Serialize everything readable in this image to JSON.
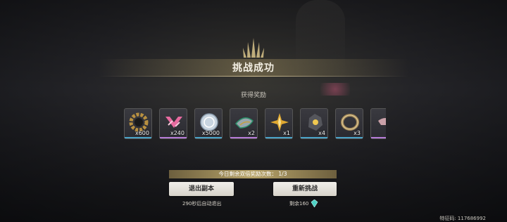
{
  "header": {
    "title": "挑战成功",
    "subtitle": "获得奖励"
  },
  "rewards": [
    {
      "icon": "gear-ring-icon",
      "qty": "x600",
      "rarity": "blue",
      "color": "#4aa3c7"
    },
    {
      "icon": "pink-emblem-icon",
      "qty": "x240",
      "rarity": "purple",
      "color": "#b57ad6"
    },
    {
      "icon": "silver-coin-icon",
      "qty": "x5000",
      "rarity": "blue",
      "color": "#4aa3c7"
    },
    {
      "icon": "shell-icon",
      "qty": "x2",
      "rarity": "purple",
      "color": "#b57ad6"
    },
    {
      "icon": "gold-star-icon",
      "qty": "x1",
      "rarity": "blue",
      "color": "#4aa3c7"
    },
    {
      "icon": "crystal-ore-icon",
      "qty": "x4",
      "rarity": "blue",
      "color": "#4aa3c7"
    },
    {
      "icon": "bracelet-icon",
      "qty": "x3",
      "rarity": "blue",
      "color": "#4aa3c7"
    },
    {
      "icon": "cut-off-item-icon",
      "qty": "",
      "rarity": "purple",
      "color": "#b57ad6"
    }
  ],
  "bonus": {
    "text": "今日剩余双倍奖励次数：  1/3"
  },
  "actions": {
    "exit_label": "退出副本",
    "retry_label": "重新挑战",
    "auto_exit_note": "290秒后自动退出",
    "remaining_label": "剩余160"
  },
  "footer": {
    "uid": "特征码: 117686992"
  }
}
